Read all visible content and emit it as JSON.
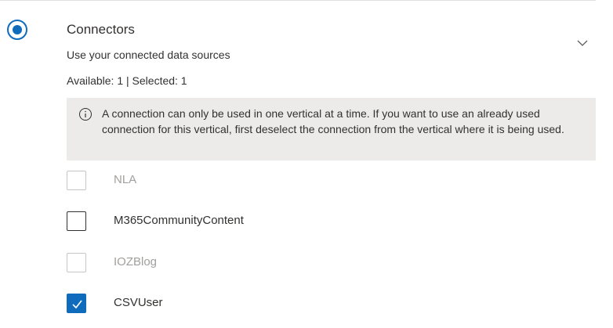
{
  "section": {
    "title": "Connectors",
    "subtitle": "Use your connected data sources",
    "selected": true
  },
  "counts": {
    "text": "Available: 1 | Selected: 1"
  },
  "info": {
    "icon": "info-icon",
    "text": "A connection can only be used in one vertical at a time. If you want to use an already used connection for this vertical, first deselect the connection from the vertical where it is being used."
  },
  "connectors": [
    {
      "label": "NLA",
      "checked": false,
      "disabled": true
    },
    {
      "label": "M365CommunityContent",
      "checked": false,
      "disabled": false
    },
    {
      "label": "IOZBlog",
      "checked": false,
      "disabled": true
    },
    {
      "label": "CSVUser",
      "checked": true,
      "disabled": false
    }
  ],
  "colors": {
    "accent": "#0f6cbd",
    "info_bg": "#edebe9",
    "disabled_text": "#a19f9d",
    "text": "#323130"
  }
}
